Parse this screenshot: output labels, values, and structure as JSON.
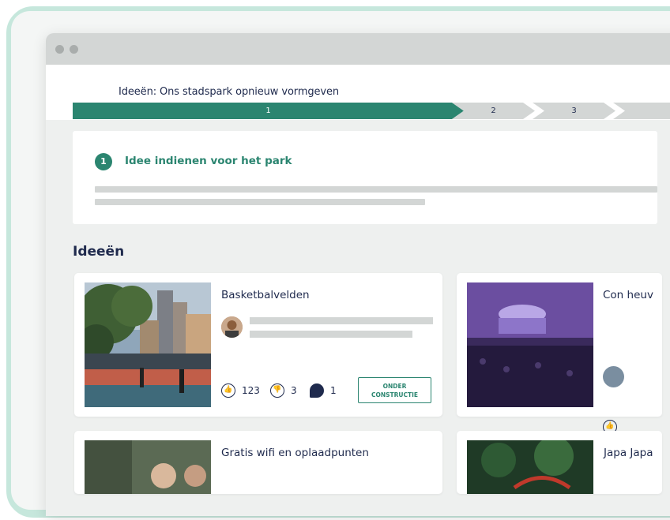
{
  "page": {
    "title": "Ideeën: Ons stadspark opnieuw vormgeven"
  },
  "steps": [
    "1",
    "2",
    "3"
  ],
  "phase": {
    "number": "1",
    "title": "Idee indienen voor het park"
  },
  "ideas_section": {
    "title": "Ideeën"
  },
  "ideas": [
    {
      "title": "Basketbalvelden",
      "likes": "123",
      "dislikes": "3",
      "comments": "1",
      "status": "ONDER CONSTRUCTIE"
    },
    {
      "title": "Con heuv"
    },
    {
      "title": "Gratis wifi en oplaadpunten"
    },
    {
      "title": "Japa Japa"
    }
  ],
  "colors": {
    "accent": "#2b8570",
    "frame": "#c6e7dc",
    "text": "#1f2a4d",
    "placeholder_bar": "#d3d6d5"
  },
  "icons": [
    "thumbs-up-icon",
    "thumbs-down-icon",
    "comment-icon"
  ]
}
